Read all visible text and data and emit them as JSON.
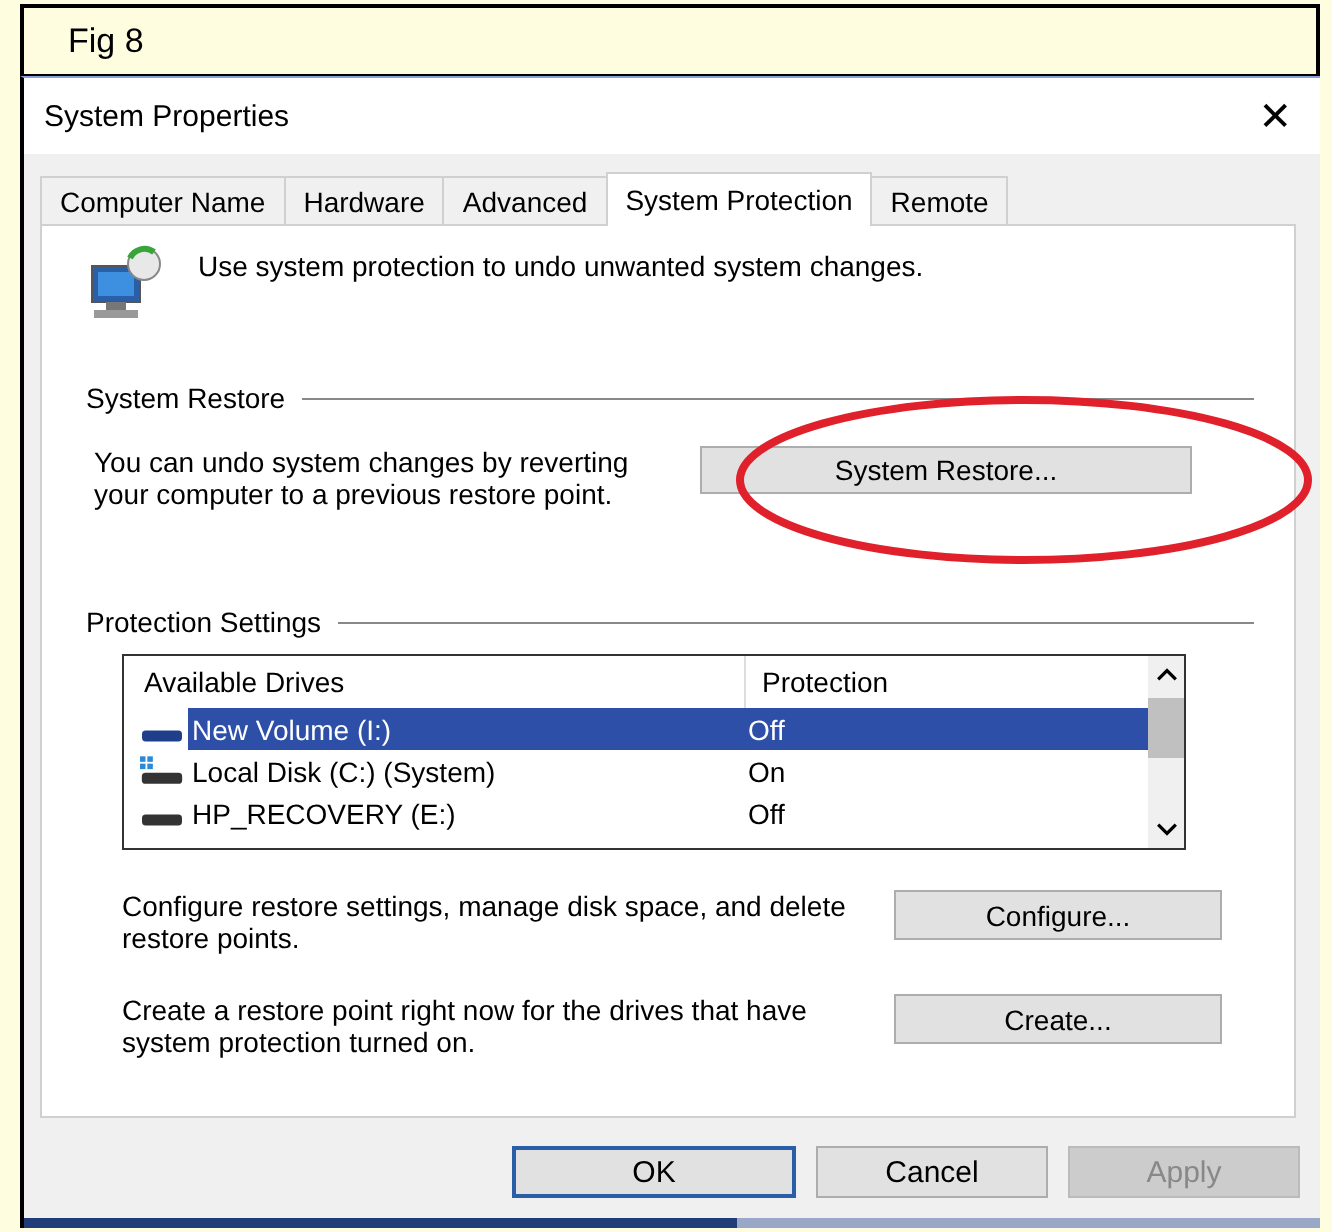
{
  "caption": "Fig 8",
  "window": {
    "title": "System Properties",
    "close": "✕"
  },
  "tabs": [
    {
      "label": "Computer Name",
      "selected": false
    },
    {
      "label": "Hardware",
      "selected": false
    },
    {
      "label": "Advanced",
      "selected": false
    },
    {
      "label": "System Protection",
      "selected": true
    },
    {
      "label": "Remote",
      "selected": false
    }
  ],
  "intro": "Use system protection to undo unwanted system changes.",
  "system_restore": {
    "heading": "System Restore",
    "text": "You can undo system changes by reverting your computer to a previous restore point.",
    "button": "System Restore..."
  },
  "protection_settings": {
    "heading": "Protection Settings",
    "columns": [
      "Available Drives",
      "Protection"
    ],
    "rows": [
      {
        "kind": "drive",
        "name": "New Volume (I:)",
        "protection": "Off",
        "selected": true
      },
      {
        "kind": "system",
        "name": "Local Disk (C:) (System)",
        "protection": "On",
        "selected": false
      },
      {
        "kind": "drive",
        "name": "HP_RECOVERY (E:)",
        "protection": "Off",
        "selected": false
      }
    ],
    "actions": [
      {
        "text": "Configure restore settings, manage disk space, and delete restore points.",
        "button": "Configure..."
      },
      {
        "text": "Create a restore point right now for the drives that have system protection turned on.",
        "button": "Create..."
      }
    ]
  },
  "buttons": [
    {
      "label": "OK",
      "default": true,
      "disabled": false
    },
    {
      "label": "Cancel",
      "default": false,
      "disabled": false
    },
    {
      "label": "Apply",
      "default": false,
      "disabled": true
    }
  ]
}
